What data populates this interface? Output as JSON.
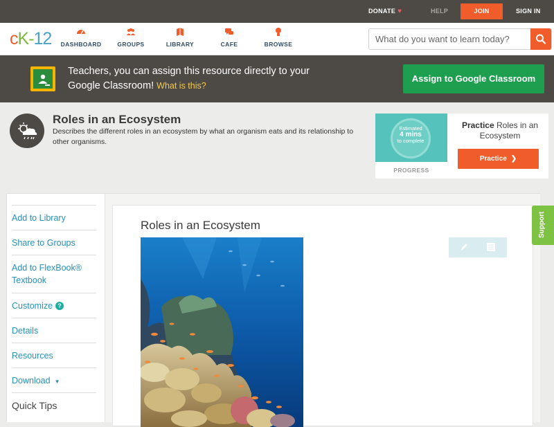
{
  "topbar": {
    "donate_label": "DONATE",
    "help_label": "HELP",
    "join_label": "JOIN",
    "signin_label": "SIGN IN"
  },
  "logo": {
    "c": "c",
    "k": "K",
    "dash": "-",
    "num": "12"
  },
  "nav": {
    "items": [
      {
        "label": "DASHBOARD",
        "icon": "dashboard-icon"
      },
      {
        "label": "GROUPS",
        "icon": "groups-icon"
      },
      {
        "label": "LIBRARY",
        "icon": "library-icon"
      },
      {
        "label": "CAFE",
        "icon": "cafe-icon"
      },
      {
        "label": "BROWSE",
        "icon": "browse-icon"
      }
    ],
    "search_placeholder": "What do you want to learn today?"
  },
  "classroom_banner": {
    "text": "Teachers, you can assign this resource directly to your Google Classroom!",
    "what_link": "What is this?",
    "button_label": "Assign to Google Classroom"
  },
  "topic": {
    "title": "Roles in an Ecosystem",
    "description": "Describes the different roles in an ecosystem by what an organism eats and its relationship to other organisms."
  },
  "practice": {
    "estimated_line1": "Estimated",
    "estimated_mins": "4 mins",
    "estimated_line3": "to complete",
    "progress_label": "PROGRESS",
    "heading_bold": "Practice",
    "heading_rest": "Roles in an Ecosystem",
    "button_label": "Practice"
  },
  "sidebar": {
    "items": [
      {
        "label": "Add to Library"
      },
      {
        "label": "Share to Groups"
      },
      {
        "label": "Add to FlexBook® Textbook"
      },
      {
        "label": "Customize"
      },
      {
        "label": "Details"
      },
      {
        "label": "Resources"
      },
      {
        "label": "Download"
      },
      {
        "label": "Quick Tips"
      }
    ]
  },
  "article": {
    "title": "Roles in an Ecosystem"
  },
  "support_label": "Support",
  "colors": {
    "brand_orange": "#f15d2a",
    "brand_green": "#79b93e",
    "brand_blue": "#4ba2c9",
    "classroom_green": "#1e9e4f",
    "dark_bar": "#4d4a45",
    "link_blue": "#2790b7"
  }
}
